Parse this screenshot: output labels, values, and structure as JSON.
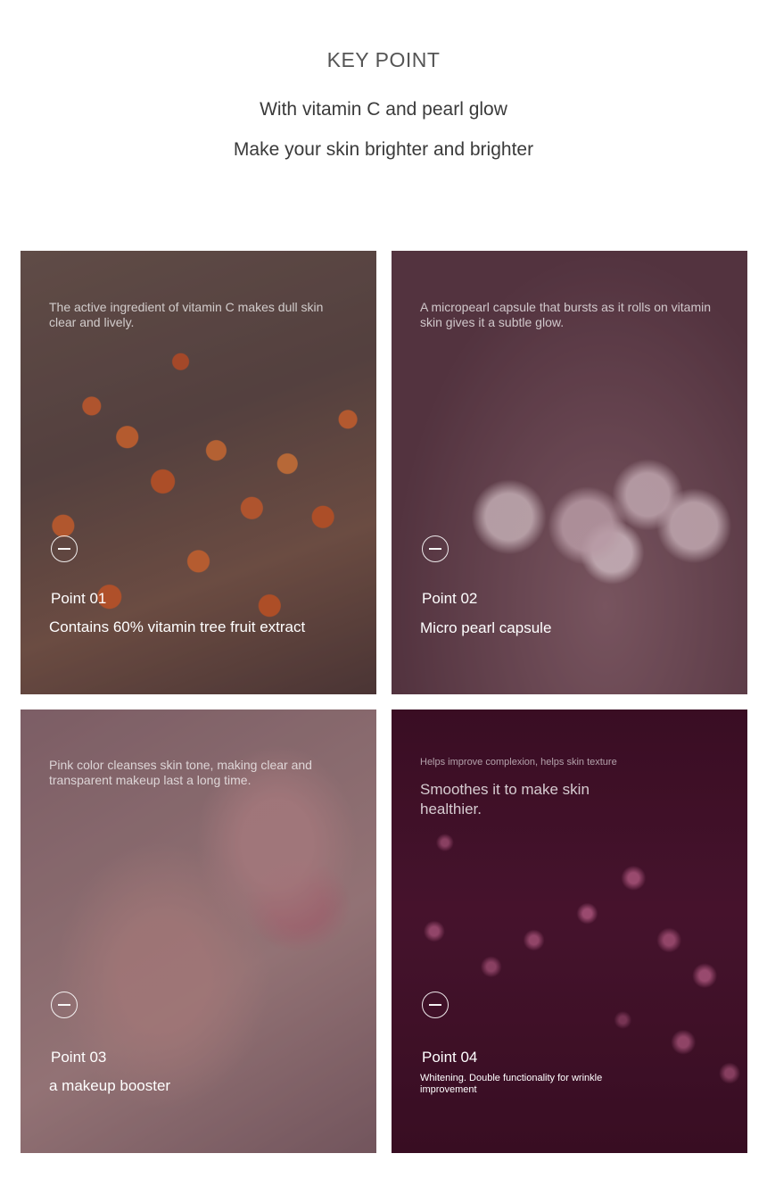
{
  "header": {
    "title": "KEY POINT",
    "subtitle_line1": "With vitamin C and pearl glow",
    "subtitle_line2": "Make your skin brighter and brighter"
  },
  "cards": [
    {
      "description": "The active ingredient of vitamin C makes dull skin clear and lively.",
      "point_label": "Point 01",
      "caption": "Contains 60% vitamin tree fruit extract"
    },
    {
      "description": "A micropearl capsule that bursts as it rolls on vitamin skin gives it a subtle glow.",
      "point_label": "Point 02",
      "caption": "Micro pearl capsule"
    },
    {
      "description": "Pink color cleanses skin tone, making clear and transparent makeup last a long time.",
      "point_label": "Point 03",
      "caption": "a makeup booster"
    },
    {
      "description_small": "Helps improve complexion, helps skin texture",
      "description_big": "Smoothes it to make skin healthier.",
      "point_label": "Point 04",
      "caption": "Whitening. Double functionality for wrinkle improvement"
    }
  ],
  "icons": {
    "minus": "minus-circle-icon"
  }
}
